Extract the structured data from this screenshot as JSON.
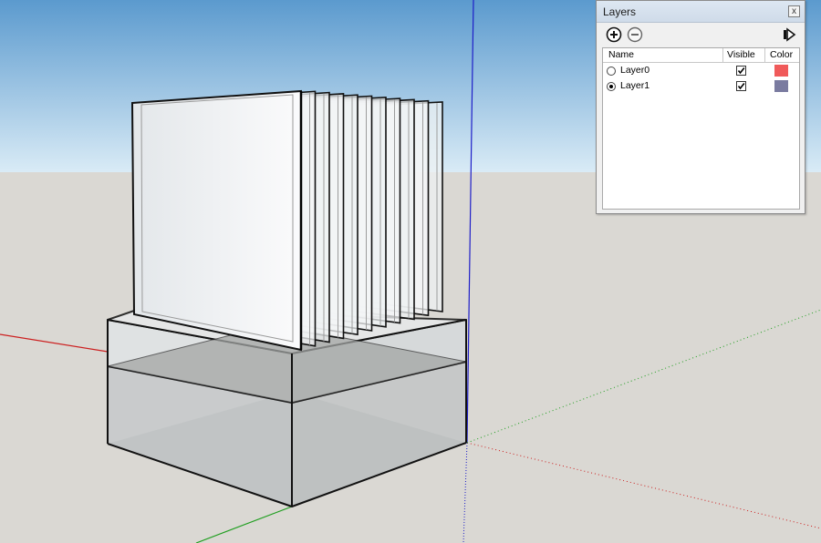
{
  "panel": {
    "title": "Layers",
    "close_glyph": "x",
    "toolbar": {
      "add_icon": "plus-circle-icon",
      "delete_icon": "minus-circle-icon",
      "details_icon": "arrow-right-icon"
    },
    "columns": [
      "Name",
      "Visible",
      "Color"
    ],
    "layers": [
      {
        "name": "Layer0",
        "active": false,
        "visible": true,
        "color": "#f05a5a"
      },
      {
        "name": "Layer1",
        "active": true,
        "visible": true,
        "color": "#7a7ba0"
      }
    ]
  },
  "scene": {
    "sky_top": "#5f9ccf",
    "sky_bottom": "#d6e8f4",
    "ground": "#dad8d3",
    "axis_red": "#cc1f1f",
    "axis_green": "#1f9e1f",
    "axis_blue": "#1e1ec8"
  }
}
